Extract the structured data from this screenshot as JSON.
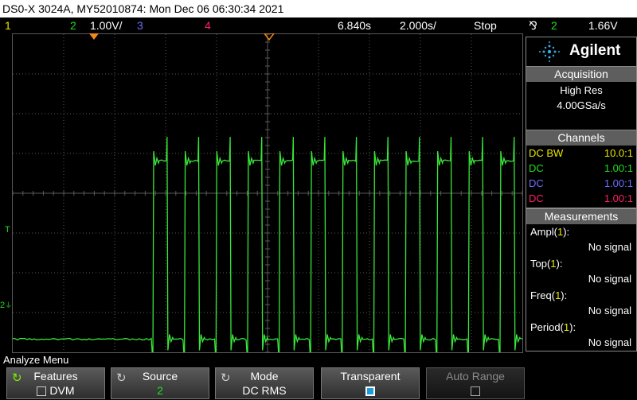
{
  "title": "DS0-X 3024A, MY52010874: Mon Dec 06 06:30:34 2021",
  "status": {
    "ch1_num": "1",
    "ch2_num": "2",
    "ch2_scale": "1.00V/",
    "ch3_num": "3",
    "ch4_num": "4",
    "delay": "6.840s",
    "timebase": "2.000s/",
    "run_state": "Stop",
    "trigger_symbol": "⅋",
    "trigger_channel": "2",
    "trigger_level": "1.66V"
  },
  "brand": "Agilent",
  "acquisition": {
    "header": "Acquisition",
    "mode": "High Res",
    "rate": "4.00GSa/s"
  },
  "channels": {
    "header": "Channels",
    "rows": [
      {
        "coupling": "DC BW",
        "ratio": "10.0:1",
        "color": "#e8e800"
      },
      {
        "coupling": "DC",
        "ratio": "1.00:1",
        "color": "#22dd22"
      },
      {
        "coupling": "DC",
        "ratio": "1.00:1",
        "color": "#6d6dff"
      },
      {
        "coupling": "DC",
        "ratio": "1.00:1",
        "color": "#ff1e6e"
      }
    ]
  },
  "measurements": {
    "header": "Measurements",
    "items": [
      {
        "label": "Ampl(",
        "ch": "1",
        "close": "):",
        "value": "No signal"
      },
      {
        "label": "Top(",
        "ch": "1",
        "close": "):",
        "value": "No signal"
      },
      {
        "label": "Freq(",
        "ch": "1",
        "close": "):",
        "value": "No signal"
      },
      {
        "label": "Period(",
        "ch": "1",
        "close": "):",
        "value": "No signal"
      }
    ]
  },
  "markers": {
    "trigger_level": "T",
    "ch2_ground": "2"
  },
  "menu": {
    "title": "Analyze Menu",
    "softkeys": [
      {
        "label": "Features",
        "value": "DVM"
      },
      {
        "label": "Source",
        "value": "2"
      },
      {
        "label": "Mode",
        "value": "DC RMS"
      },
      {
        "label": "Transparent",
        "value": ""
      },
      {
        "label": "Auto Range",
        "value": ""
      }
    ]
  },
  "colors": {
    "ch1": "#e8e800",
    "ch2": "#22dd22",
    "ch3": "#6d6dff",
    "ch4": "#ff1e6e",
    "trace": "#39e639",
    "grid": "#5a5a5a",
    "marker": "#f08a1e",
    "brand_icon": "#3aa8e0"
  },
  "waveform": {
    "pulses": 16,
    "first_rise_div": 2.75,
    "period_div": 0.516,
    "duty": 0.5,
    "high_div": 5.1,
    "low_div": 0.05,
    "last_fall_div": 11.08
  }
}
